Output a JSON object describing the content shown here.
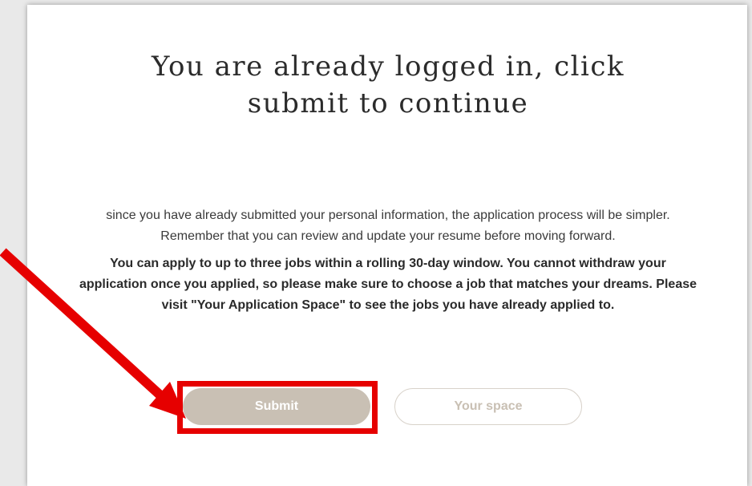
{
  "dialog": {
    "title": "You are already logged in, click submit to continue",
    "paragraph1": "since you have already submitted your personal information, the application process will be simpler. Remember that you can review and update your resume before moving forward.",
    "paragraph2": "You can apply to up to three jobs within a rolling 30-day window. You cannot withdraw your application once you applied, so please make sure to choose a job that matches your dreams. Please visit \"Your Application Space\" to see the jobs you have already applied to."
  },
  "buttons": {
    "submit_label": "Submit",
    "your_space_label": "Your space"
  },
  "colors": {
    "accent": "#c9c0b4",
    "annotation": "#e60000"
  },
  "annotation": {
    "icon": "arrow-icon"
  }
}
